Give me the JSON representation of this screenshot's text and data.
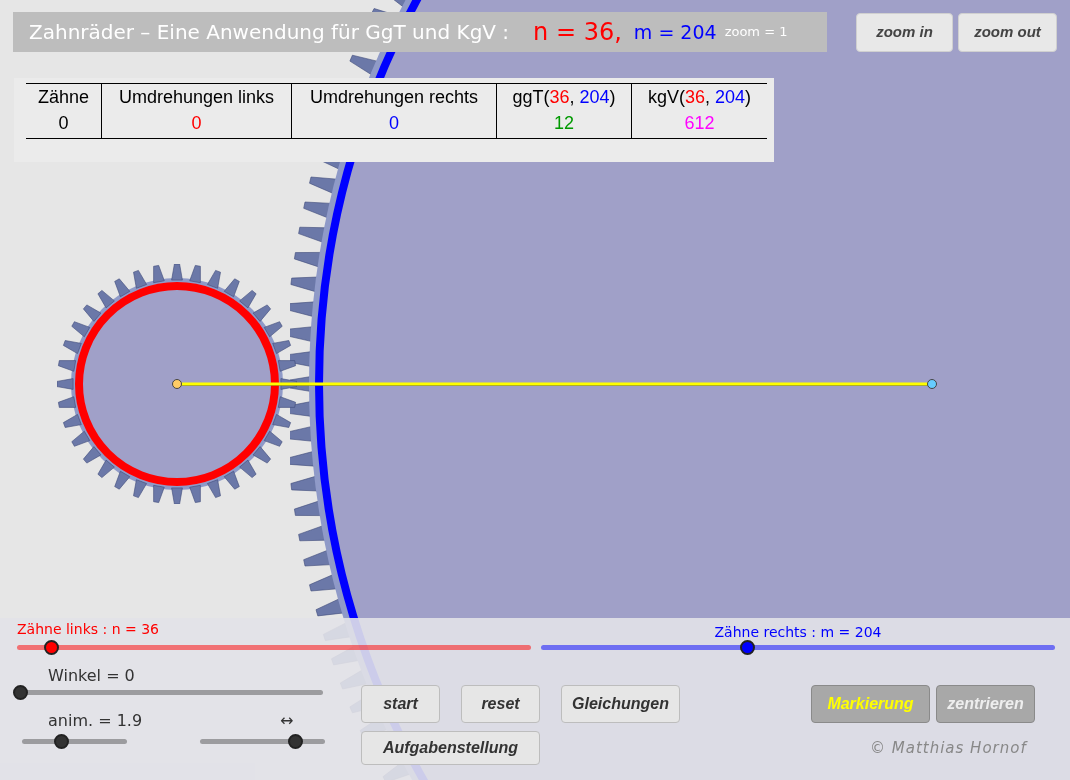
{
  "title": {
    "text": "Zahnräder – Eine Anwendung für GgT und KgV :",
    "n": "n = 36,",
    "m": "m = 204",
    "zoom": "zoom = 1"
  },
  "zoom_buttons": [
    "zoom in",
    "zoom out"
  ],
  "table": {
    "columns": [
      {
        "kind": "text",
        "label": "Zähne"
      },
      {
        "kind": "text",
        "label": "Umdrehungen links"
      },
      {
        "kind": "text",
        "label": "Umdrehungen rechts"
      },
      {
        "kind": "function",
        "prefix": "ggT(",
        "n": "36",
        "sep": ", ",
        "m": "204",
        "suffix": ")"
      },
      {
        "kind": "function",
        "prefix": "kgV(",
        "n": "36",
        "sep": ", ",
        "m": "204",
        "suffix": ")"
      }
    ],
    "row": [
      {
        "value": "0",
        "color": "#000000"
      },
      {
        "value": "0",
        "color": "#ff0000"
      },
      {
        "value": "0",
        "color": "#0000ff"
      },
      {
        "value": "12",
        "color": "#009900"
      },
      {
        "value": "612",
        "color": "#ff00ff"
      }
    ]
  },
  "sliders": [
    {
      "label": "Zähne links :  n = 36",
      "color": "#ff0000",
      "level": 0.066
    },
    {
      "label": "Zähne rechts :  m = 204",
      "color": "#0000ff",
      "level": 0.4
    },
    {
      "label": "Winkel = 0",
      "color": "#333333",
      "level": 0
    },
    {
      "label": "anim. = 1.9",
      "color": "#333333",
      "level": 0.37
    },
    {
      "label": "↔",
      "color": "#333333",
      "level": 0.76
    }
  ],
  "buttons": [
    {
      "label": "start",
      "kind": "plain"
    },
    {
      "label": "reset",
      "kind": "plain"
    },
    {
      "label": "Gleichungen",
      "kind": "plain"
    },
    {
      "label": "Markierung",
      "kind": "toggle",
      "on": true
    },
    {
      "label": "zentrieren",
      "kind": "toggle",
      "on": false
    },
    {
      "label": "Aufgabenstellung",
      "kind": "plain"
    }
  ],
  "copyright": "© Matthias Hornof"
}
